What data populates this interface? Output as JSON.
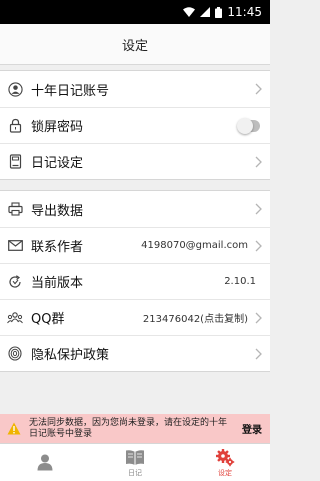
{
  "status_bar": {
    "time": "11:45"
  },
  "header": {
    "title": "设定"
  },
  "groups": [
    {
      "items": [
        {
          "label": "十年日记账号",
          "icon": "person-icon"
        },
        {
          "label": "锁屏密码",
          "icon": "lock-icon",
          "toggle_on": false
        },
        {
          "label": "日记设定",
          "icon": "notebook-icon"
        }
      ]
    },
    {
      "items": [
        {
          "label": "导出数据",
          "icon": "printer-icon"
        },
        {
          "label": "联系作者",
          "icon": "mail-icon",
          "value": "4198070@gmail.com"
        },
        {
          "label": "当前版本",
          "icon": "refresh-icon",
          "value": "2.10.1"
        },
        {
          "label": "QQ群",
          "icon": "group-icon",
          "value": "213476042(点击复制)"
        },
        {
          "label": "隐私保护政策",
          "icon": "fingerprint-icon"
        }
      ]
    }
  ],
  "banner": {
    "message": "无法同步数据，因为您尚未登录，请在设定的十年日记账号中登录",
    "action": "登录"
  },
  "tabs": [
    {
      "label": "",
      "icon": "person-icon",
      "active": false
    },
    {
      "label": "日记",
      "icon": "book-icon",
      "active": false
    },
    {
      "label": "设定",
      "icon": "gear-icon",
      "active": true
    }
  ],
  "colors": {
    "accent": "#e0403a",
    "banner_bg": "#f9c8c8",
    "background": "#efefef"
  }
}
